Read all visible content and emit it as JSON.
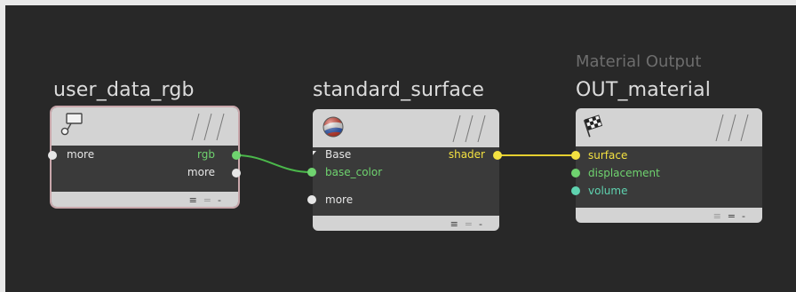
{
  "nodes": {
    "user_data_rgb": {
      "title": "user_data_rgb",
      "inputs": [
        "more"
      ],
      "outputs": [
        "rgb",
        "more"
      ]
    },
    "standard_surface": {
      "title": "standard_surface",
      "section": "Base",
      "inputs": [
        "base_color",
        "more"
      ],
      "outputs": [
        "shader"
      ]
    },
    "out_material": {
      "title": "OUT_material",
      "subtitle": "Material Output",
      "inputs": [
        "surface",
        "displacement",
        "volume"
      ]
    }
  },
  "footer_icons": [
    "≡",
    "=",
    "-"
  ],
  "colors": {
    "background": "#282828",
    "node_body": "#3a3a3a",
    "node_header": "#d3d3d3",
    "selected_outline": "#c9a7ab",
    "vector_port": "#6fd36f",
    "shader_port": "#f3e141",
    "volume_port": "#5fd3b0",
    "generic_port": "#e6e6e6"
  },
  "icons": {
    "user_data_rgb": "speech-bubble-icon",
    "standard_surface": "shader-ball-icon",
    "out_material": "checkered-flag-icon"
  }
}
